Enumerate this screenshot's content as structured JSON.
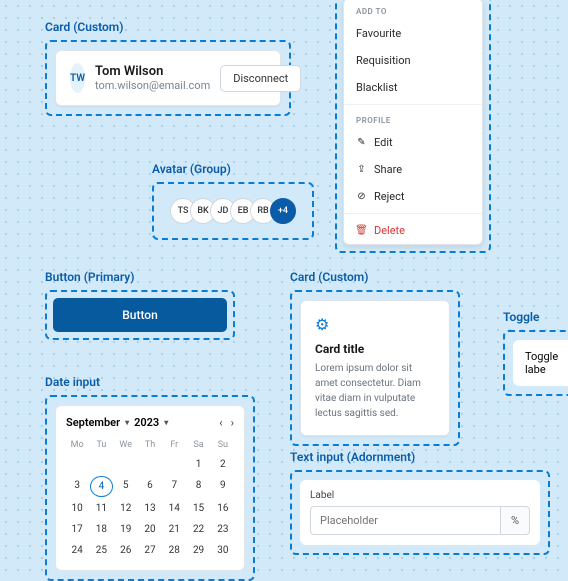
{
  "userCard": {
    "label": "Card (Custom)",
    "initials": "TW",
    "name": "Tom Wilson",
    "email": "tom.wilson@email.com",
    "action": "Disconnect"
  },
  "avatarGroup": {
    "label": "Avatar (Group)",
    "items": [
      "TS",
      "BK",
      "JD",
      "EB",
      "RB"
    ],
    "more": "+4"
  },
  "button": {
    "label": "Button (Primary)",
    "text": "Button"
  },
  "menu": {
    "sec1": "ADD TO",
    "items1": [
      "Favourite",
      "Requisition",
      "Blacklist"
    ],
    "sec2": "PROFILE",
    "items2": [
      "Edit",
      "Share",
      "Reject"
    ],
    "del": "Delete"
  },
  "card2": {
    "label": "Card (Custom)",
    "title": "Card title",
    "body": "Lorem ipsum dolor sit amet consectetur. Diam vitae diam in vulputate lectus sagittis sed."
  },
  "toggle": {
    "label": "Toggle",
    "text": "Toggle labe"
  },
  "dateInput": {
    "label": "Date input",
    "month": "September",
    "year": "2023",
    "dow": [
      "Mo",
      "Tu",
      "We",
      "Th",
      "Fr",
      "Sa",
      "Su"
    ]
  },
  "textInput": {
    "label": "Text input (Adornment)",
    "fieldLabel": "Label",
    "placeholder": "Placeholder",
    "adorn": "%"
  }
}
